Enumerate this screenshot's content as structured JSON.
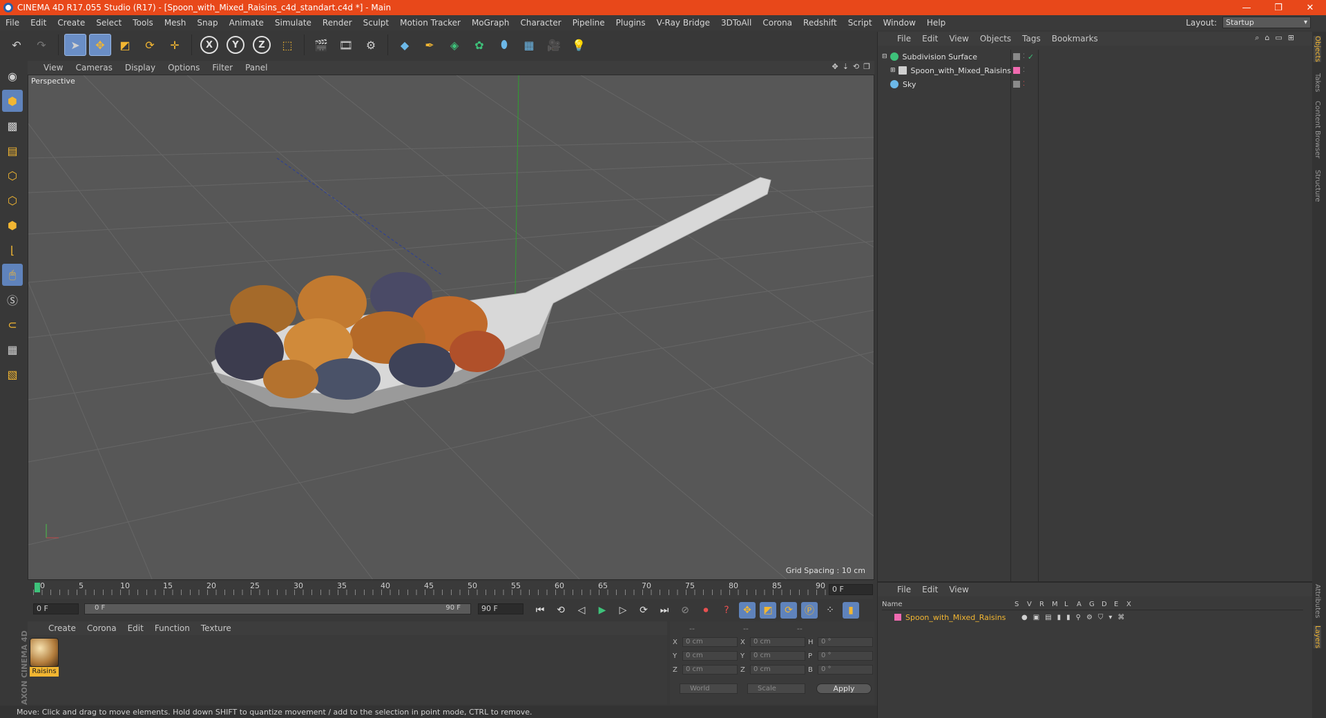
{
  "window": {
    "title": "CINEMA 4D R17.055 Studio (R17) - [Spoon_with_Mixed_Raisins_c4d_standart.c4d *] - Main",
    "controls": [
      "—",
      "❐",
      "✕"
    ]
  },
  "menubar": {
    "items": [
      "File",
      "Edit",
      "Create",
      "Select",
      "Tools",
      "Mesh",
      "Snap",
      "Animate",
      "Simulate",
      "Render",
      "Sculpt",
      "Motion Tracker",
      "MoGraph",
      "Character",
      "Pipeline",
      "Plugins",
      "V-Ray Bridge",
      "3DToAll",
      "Corona",
      "Redshift",
      "Script",
      "Window",
      "Help"
    ],
    "layout_label": "Layout:",
    "layout_value": "Startup"
  },
  "toolbar": {
    "axis_x": "X",
    "axis_y": "Y",
    "axis_z": "Z"
  },
  "viewport": {
    "menu": [
      "View",
      "Cameras",
      "Display",
      "Options",
      "Filter",
      "Panel"
    ],
    "label": "Perspective",
    "grid_spacing": "Grid Spacing : 10 cm"
  },
  "timeline": {
    "ticks": [
      "0",
      "5",
      "10",
      "15",
      "20",
      "25",
      "30",
      "35",
      "40",
      "45",
      "50",
      "55",
      "60",
      "65",
      "70",
      "75",
      "80",
      "85",
      "90"
    ],
    "current_frame": "0 F",
    "start_frame": "0 F",
    "range_start": "0 F",
    "range_end": "90 F",
    "end_frame": "90 F"
  },
  "material_panel": {
    "menu": [
      "Create",
      "Corona",
      "Edit",
      "Function",
      "Texture"
    ],
    "material_name": "Raisins"
  },
  "coord_panel": {
    "headers": [
      "--",
      "--",
      "--"
    ],
    "rows": [
      {
        "k1": "X",
        "v1": "0 cm",
        "k2": "X",
        "v2": "0 cm",
        "k3": "H",
        "v3": "0 °"
      },
      {
        "k1": "Y",
        "v1": "0 cm",
        "k2": "Y",
        "v2": "0 cm",
        "k3": "P",
        "v3": "0 °"
      },
      {
        "k1": "Z",
        "v1": "0 cm",
        "k2": "Z",
        "v2": "0 cm",
        "k3": "B",
        "v3": "0 °"
      }
    ],
    "mode1": "World",
    "mode2": "Scale",
    "apply": "Apply"
  },
  "status": "Move: Click and drag to move elements. Hold down SHIFT to quantize movement / add to the selection in point mode, CTRL to remove.",
  "object_manager": {
    "menu": [
      "File",
      "Edit",
      "View",
      "Objects",
      "Tags",
      "Bookmarks"
    ],
    "objects": [
      {
        "name": "Subdivision Surface",
        "icon_color": "#3ec27a"
      },
      {
        "name": "Spoon_with_Mixed_Raisins",
        "icon_color": "#cfcfcf"
      },
      {
        "name": "Sky",
        "icon_color": "#6cb8e8"
      }
    ]
  },
  "layer_manager": {
    "menu": [
      "File",
      "Edit",
      "View"
    ],
    "columns": [
      "Name",
      "S",
      "V",
      "R",
      "M",
      "L",
      "A",
      "G",
      "D",
      "E",
      "X"
    ],
    "layer_name": "Spoon_with_Mixed_Raisins"
  },
  "side_tabs": [
    "Objects",
    "Takes",
    "Content Browser",
    "Structure",
    "Attributes",
    "Layers"
  ],
  "brand": "MAXON CINEMA 4D"
}
